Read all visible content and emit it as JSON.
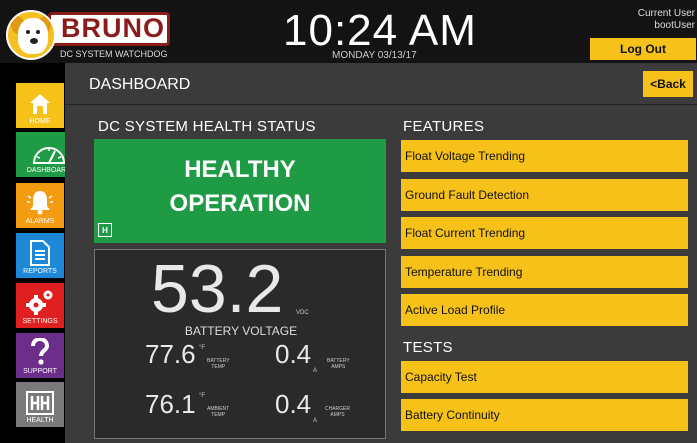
{
  "header": {
    "brand": "BRUNO",
    "brand_subtitle": "DC SYSTEM WATCHDOG",
    "time": "10:24 AM",
    "date": "MONDAY 03/13/17",
    "current_user_label": "Current User",
    "username": "bootUser",
    "logout_label": "Log Out"
  },
  "sidebar": {
    "items": [
      {
        "label": "HOME",
        "icon": "home-icon",
        "color": "#f6c21a"
      },
      {
        "label": "DASHBOARD",
        "icon": "gauge-icon",
        "color": "#1f9b45"
      },
      {
        "label": "ALARMS",
        "icon": "bell-icon",
        "color": "#f39c12"
      },
      {
        "label": "REPORTS",
        "icon": "document-icon",
        "color": "#1e88d8"
      },
      {
        "label": "SETTINGS",
        "icon": "gears-icon",
        "color": "#e02020"
      },
      {
        "label": "SUPPORT",
        "icon": "question-icon",
        "color": "#6b2e8a"
      },
      {
        "label": "HEALTH",
        "icon": "health-icon",
        "color": "#7a7a7a"
      }
    ]
  },
  "main": {
    "page_title": "DASHBOARD",
    "back_label": "<Back",
    "health": {
      "section_title": "DC SYSTEM HEALTH STATUS",
      "status_line1": "HEALTHY",
      "status_line2": "OPERATION",
      "badge": "H",
      "color": "#1f9b45"
    },
    "voltage": {
      "value": "53.2",
      "unit": "VDC",
      "label": "BATTERY VOLTAGE",
      "battery_temp": {
        "value": "77.6",
        "unit": "°F",
        "label1": "BATTERY",
        "label2": "TEMP"
      },
      "battery_amps": {
        "value": "0.4",
        "unit": "A",
        "label1": "BATTERY",
        "label2": "AMPS"
      },
      "ambient_temp": {
        "value": "76.1",
        "unit": "°F",
        "label1": "AMBIENT",
        "label2": "TEMP"
      },
      "charger_amps": {
        "value": "0.4",
        "unit": "A",
        "label1": "CHARGER",
        "label2": "AMPS"
      }
    },
    "features": {
      "title": "FEATURES",
      "items": [
        "Float Voltage Trending",
        "Ground Fault Detection",
        "Float Current Trending",
        "Temperature Trending",
        "Active Load Profile"
      ]
    },
    "tests": {
      "title": "TESTS",
      "items": [
        "Capacity Test",
        "Battery Continuity"
      ]
    }
  },
  "colors": {
    "accent": "#f6c21a",
    "healthy": "#1f9b45"
  }
}
